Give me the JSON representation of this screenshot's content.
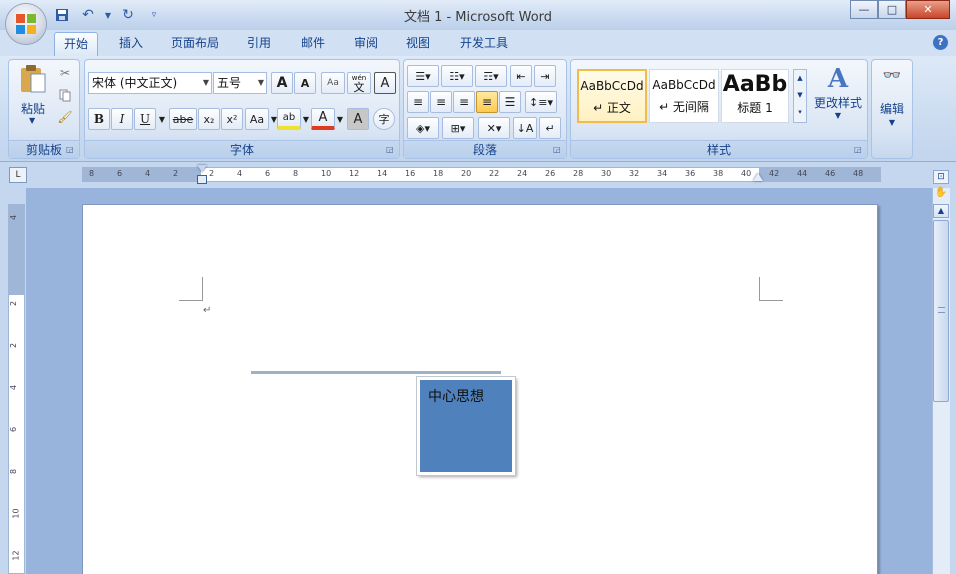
{
  "window": {
    "title": "文档 1 - Microsoft Word",
    "controls": {
      "minimize": "—",
      "maximize": "□",
      "close": "✕"
    }
  },
  "quick_access": {
    "save_icon": "save-icon",
    "undo_icon": "undo-icon",
    "redo_icon": "redo-icon",
    "customize_icon": "customize-icon"
  },
  "tabs": [
    "开始",
    "插入",
    "页面布局",
    "引用",
    "邮件",
    "审阅",
    "视图",
    "开发工具"
  ],
  "active_tab": "开始",
  "help": "?",
  "ribbon": {
    "clipboard": {
      "label": "剪贴板",
      "paste": "粘贴"
    },
    "font": {
      "label": "字体",
      "font_name": "宋体 (中文正文)",
      "font_size": "五号",
      "grow": "A",
      "shrink": "A",
      "clear_format": "Aa",
      "phonetic": "wén",
      "phonetic_char": "文",
      "border_char": "A",
      "bold": "B",
      "italic": "I",
      "underline": "U",
      "strike": "abe",
      "subscript": "x₂",
      "superscript": "x²",
      "change_case": "Aa",
      "highlight": "ab",
      "font_color": "A",
      "char_shade": "A",
      "enclose": "字"
    },
    "paragraph": {
      "label": "段落"
    },
    "styles": {
      "label": "样式",
      "cards": [
        {
          "preview": "AaBbCcDd",
          "name": "↵ 正文"
        },
        {
          "preview": "AaBbCcDd",
          "name": "↵ 无间隔"
        },
        {
          "preview": "AaBb",
          "name": "标题 1"
        }
      ],
      "change_styles": "更改样式"
    },
    "editing": {
      "label": "编辑"
    }
  },
  "ruler": {
    "h_ticks": [
      "8",
      "6",
      "4",
      "2",
      "2",
      "4",
      "6",
      "8",
      "10",
      "12",
      "14",
      "16",
      "18",
      "20",
      "22",
      "24",
      "26",
      "28",
      "30",
      "32",
      "34",
      "36",
      "38",
      "40",
      "42",
      "44",
      "46",
      "48"
    ],
    "v_ticks": [
      "4",
      "2",
      "2",
      "4",
      "6",
      "8",
      "10",
      "12"
    ]
  },
  "document": {
    "shape_text": "中心思想",
    "paragraph_mark": "↵",
    "shape_color": "#4f81bd"
  }
}
